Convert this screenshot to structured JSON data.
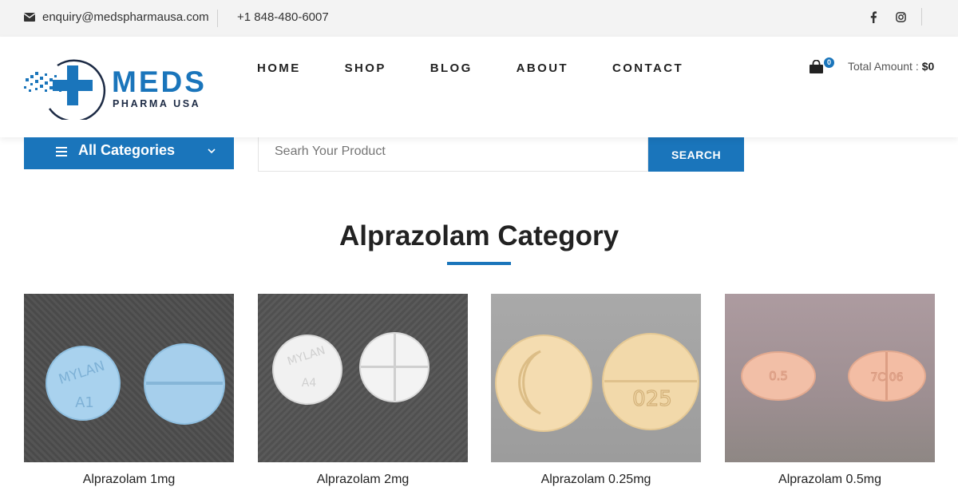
{
  "topbar": {
    "email": "enquiry@medspharmausa.com",
    "phone": "+1 848-480-6007"
  },
  "header": {
    "logo_brand": "MEDS",
    "logo_sub": "PHARMA USA",
    "nav": [
      "HOME",
      "SHOP",
      "BLOG",
      "ABOUT",
      "CONTACT"
    ],
    "cart_count": "0",
    "total_label": "Total Amount :",
    "total_value": "$0"
  },
  "search": {
    "categories_label": "All Categories",
    "placeholder": "Searh Your Product",
    "button_label": "SEARCH"
  },
  "section": {
    "title": "Alprazolam Category"
  },
  "products": [
    {
      "name": "Alprazolam 1mg",
      "pill_marks": [
        "MYLAN",
        "A1"
      ]
    },
    {
      "name": "Alprazolam 2mg",
      "pill_marks": [
        "MYLAN",
        "A4"
      ]
    },
    {
      "name": "Alprazolam 0.25mg",
      "pill_marks": [
        "025"
      ]
    },
    {
      "name": "Alprazolam 0.5mg",
      "pill_marks": [
        "0.5",
        "7C 06"
      ]
    }
  ],
  "colors": {
    "accent": "#1a75bb",
    "topbar_bg": "#f3f3f3"
  }
}
